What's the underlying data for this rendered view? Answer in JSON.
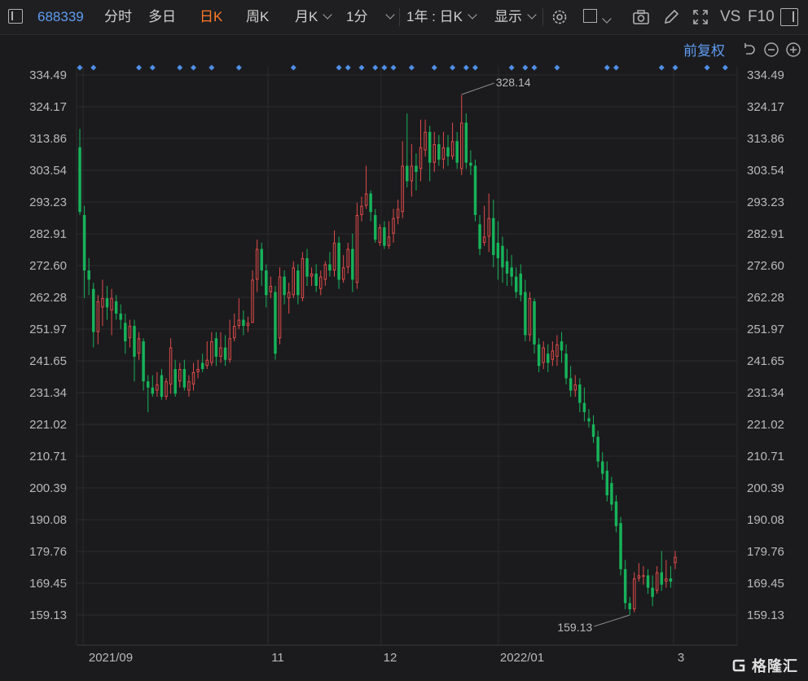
{
  "toolbar": {
    "stock_code": "688339",
    "tabs": [
      "分时",
      "多日",
      "日K",
      "周K",
      "月K",
      "1分"
    ],
    "active_tab": "日K",
    "period_select": "1年 : 日K",
    "display_label": "显示",
    "vs_label": "VS",
    "f10_label": "F10"
  },
  "adjust_label": "前复权",
  "colors": {
    "up": "#e14b4b",
    "down": "#17b35a",
    "marker": "#4f8fe8",
    "grid": "#2b2b2d",
    "annotation": "#8a8a8a"
  },
  "chart_data": {
    "type": "candlestick",
    "y_ticks": [
      "334.49",
      "324.17",
      "313.86",
      "303.54",
      "293.23",
      "282.91",
      "272.60",
      "262.28",
      "251.97",
      "241.65",
      "231.34",
      "221.02",
      "210.71",
      "200.39",
      "190.08",
      "179.76",
      "169.45",
      "159.13"
    ],
    "ylim": [
      159.13,
      334.49
    ],
    "x_labels": [
      "2021/09",
      "11",
      "12",
      "2022/01",
      "3"
    ],
    "annotations": [
      {
        "text": "328.14",
        "value": 328.14,
        "type": "high"
      },
      {
        "text": "159.13",
        "value": 159.13,
        "type": "low"
      }
    ],
    "series": [
      {
        "o": 311,
        "c": 290,
        "h": 317,
        "l": 289
      },
      {
        "o": 289,
        "c": 271,
        "h": 292,
        "l": 262
      },
      {
        "o": 271,
        "c": 268,
        "h": 275,
        "l": 263
      },
      {
        "o": 265,
        "c": 251,
        "h": 267,
        "l": 246
      },
      {
        "o": 251,
        "c": 261,
        "h": 263,
        "l": 247
      },
      {
        "o": 259,
        "c": 262,
        "h": 268,
        "l": 253
      },
      {
        "o": 262,
        "c": 259,
        "h": 266,
        "l": 255
      },
      {
        "o": 258,
        "c": 262,
        "h": 265,
        "l": 250
      },
      {
        "o": 261,
        "c": 257,
        "h": 263,
        "l": 255
      },
      {
        "o": 257,
        "c": 255,
        "h": 260,
        "l": 252
      },
      {
        "o": 254,
        "c": 248,
        "h": 257,
        "l": 244
      },
      {
        "o": 249,
        "c": 253,
        "h": 255,
        "l": 246
      },
      {
        "o": 253,
        "c": 243,
        "h": 255,
        "l": 235
      },
      {
        "o": 244,
        "c": 249,
        "h": 251,
        "l": 242
      },
      {
        "o": 248,
        "c": 235,
        "h": 249,
        "l": 232
      },
      {
        "o": 235,
        "c": 233,
        "h": 237,
        "l": 225
      },
      {
        "o": 233,
        "c": 231,
        "h": 237,
        "l": 230
      },
      {
        "o": 232,
        "c": 234,
        "h": 238,
        "l": 230
      },
      {
        "o": 237,
        "c": 230,
        "h": 239,
        "l": 229
      },
      {
        "o": 230,
        "c": 235,
        "h": 236,
        "l": 229
      },
      {
        "o": 234,
        "c": 246,
        "h": 249,
        "l": 231
      },
      {
        "o": 239,
        "c": 231,
        "h": 242,
        "l": 230
      },
      {
        "o": 235,
        "c": 239,
        "h": 241,
        "l": 233
      },
      {
        "o": 239,
        "c": 233,
        "h": 242,
        "l": 232
      },
      {
        "o": 232,
        "c": 235,
        "h": 237,
        "l": 230
      },
      {
        "o": 234,
        "c": 238,
        "h": 241,
        "l": 232
      },
      {
        "o": 238,
        "c": 239,
        "h": 242,
        "l": 236
      },
      {
        "o": 241,
        "c": 239,
        "h": 244,
        "l": 238
      },
      {
        "o": 240,
        "c": 242,
        "h": 248,
        "l": 239
      },
      {
        "o": 241,
        "c": 248,
        "h": 251,
        "l": 240
      },
      {
        "o": 249,
        "c": 243,
        "h": 251,
        "l": 240
      },
      {
        "o": 243,
        "c": 246,
        "h": 251,
        "l": 241
      },
      {
        "o": 246,
        "c": 242,
        "h": 250,
        "l": 240
      },
      {
        "o": 242,
        "c": 249,
        "h": 255,
        "l": 241
      },
      {
        "o": 249,
        "c": 253,
        "h": 257,
        "l": 248
      },
      {
        "o": 253,
        "c": 255,
        "h": 262,
        "l": 252
      },
      {
        "o": 255,
        "c": 253,
        "h": 258,
        "l": 250
      },
      {
        "o": 253,
        "c": 254,
        "h": 256,
        "l": 251
      },
      {
        "o": 254,
        "c": 268,
        "h": 271,
        "l": 254
      },
      {
        "o": 268,
        "c": 278,
        "h": 281,
        "l": 264
      },
      {
        "o": 278,
        "c": 271,
        "h": 280,
        "l": 266
      },
      {
        "o": 271,
        "c": 263,
        "h": 273,
        "l": 259
      },
      {
        "o": 264,
        "c": 266,
        "h": 269,
        "l": 262
      },
      {
        "o": 264,
        "c": 244,
        "h": 266,
        "l": 242
      },
      {
        "o": 249,
        "c": 269,
        "h": 272,
        "l": 247
      },
      {
        "o": 269,
        "c": 263,
        "h": 271,
        "l": 260
      },
      {
        "o": 262,
        "c": 264,
        "h": 267,
        "l": 257
      },
      {
        "o": 263,
        "c": 272,
        "h": 274,
        "l": 262
      },
      {
        "o": 271,
        "c": 263,
        "h": 273,
        "l": 260
      },
      {
        "o": 262,
        "c": 275,
        "h": 277,
        "l": 261
      },
      {
        "o": 275,
        "c": 269,
        "h": 278,
        "l": 266
      },
      {
        "o": 269,
        "c": 270,
        "h": 272,
        "l": 266
      },
      {
        "o": 270,
        "c": 266,
        "h": 273,
        "l": 264
      },
      {
        "o": 265,
        "c": 269,
        "h": 271,
        "l": 263
      },
      {
        "o": 268,
        "c": 273,
        "h": 274,
        "l": 266
      },
      {
        "o": 273,
        "c": 271,
        "h": 277,
        "l": 269
      },
      {
        "o": 271,
        "c": 280,
        "h": 284,
        "l": 269
      },
      {
        "o": 280,
        "c": 268,
        "h": 282,
        "l": 265
      },
      {
        "o": 268,
        "c": 272,
        "h": 276,
        "l": 267
      },
      {
        "o": 272,
        "c": 278,
        "h": 280,
        "l": 270
      },
      {
        "o": 278,
        "c": 268,
        "h": 283,
        "l": 264
      },
      {
        "o": 267,
        "c": 289,
        "h": 293,
        "l": 265
      },
      {
        "o": 289,
        "c": 292,
        "h": 295,
        "l": 287
      },
      {
        "o": 292,
        "c": 296,
        "h": 305,
        "l": 291
      },
      {
        "o": 296,
        "c": 290,
        "h": 297,
        "l": 287
      },
      {
        "o": 289,
        "c": 281,
        "h": 291,
        "l": 280
      },
      {
        "o": 280,
        "c": 285,
        "h": 286,
        "l": 279
      },
      {
        "o": 285,
        "c": 279,
        "h": 287,
        "l": 278
      },
      {
        "o": 279,
        "c": 282,
        "h": 287,
        "l": 278
      },
      {
        "o": 283,
        "c": 288,
        "h": 291,
        "l": 280
      },
      {
        "o": 288,
        "c": 291,
        "h": 294,
        "l": 286
      },
      {
        "o": 290,
        "c": 305,
        "h": 313,
        "l": 288
      },
      {
        "o": 305,
        "c": 300,
        "h": 322,
        "l": 298
      },
      {
        "o": 300,
        "c": 305,
        "h": 312,
        "l": 295
      },
      {
        "o": 305,
        "c": 303,
        "h": 309,
        "l": 297
      },
      {
        "o": 304,
        "c": 311,
        "h": 320,
        "l": 300
      },
      {
        "o": 310,
        "c": 316,
        "h": 320,
        "l": 308
      },
      {
        "o": 316,
        "c": 306,
        "h": 318,
        "l": 300
      },
      {
        "o": 306,
        "c": 312,
        "h": 316,
        "l": 303
      },
      {
        "o": 312,
        "c": 307,
        "h": 315,
        "l": 305
      },
      {
        "o": 307,
        "c": 311,
        "h": 316,
        "l": 304
      },
      {
        "o": 311,
        "c": 308,
        "h": 315,
        "l": 305
      },
      {
        "o": 308,
        "c": 313,
        "h": 319,
        "l": 307
      },
      {
        "o": 313,
        "c": 306,
        "h": 316,
        "l": 304
      },
      {
        "o": 304,
        "c": 319,
        "h": 328,
        "l": 302
      },
      {
        "o": 319,
        "c": 306,
        "h": 322,
        "l": 304
      },
      {
        "o": 306,
        "c": 305,
        "h": 310,
        "l": 302
      },
      {
        "o": 305,
        "c": 289,
        "h": 307,
        "l": 287
      },
      {
        "o": 286,
        "c": 278,
        "h": 289,
        "l": 276
      },
      {
        "o": 280,
        "c": 282,
        "h": 292,
        "l": 279
      },
      {
        "o": 282,
        "c": 288,
        "h": 296,
        "l": 277
      },
      {
        "o": 288,
        "c": 276,
        "h": 294,
        "l": 272
      },
      {
        "o": 280,
        "c": 275,
        "h": 287,
        "l": 268
      },
      {
        "o": 279,
        "c": 272,
        "h": 282,
        "l": 267
      },
      {
        "o": 274,
        "c": 270,
        "h": 278,
        "l": 266
      },
      {
        "o": 272,
        "c": 269,
        "h": 276,
        "l": 266
      },
      {
        "o": 269,
        "c": 264,
        "h": 272,
        "l": 262
      },
      {
        "o": 270,
        "c": 263,
        "h": 273,
        "l": 261
      },
      {
        "o": 264,
        "c": 250,
        "h": 268,
        "l": 248
      },
      {
        "o": 250,
        "c": 262,
        "h": 264,
        "l": 248
      },
      {
        "o": 261,
        "c": 247,
        "h": 262,
        "l": 244
      },
      {
        "o": 247,
        "c": 240,
        "h": 249,
        "l": 238
      },
      {
        "o": 241,
        "c": 246,
        "h": 248,
        "l": 239
      },
      {
        "o": 244,
        "c": 241,
        "h": 247,
        "l": 238
      },
      {
        "o": 242,
        "c": 245,
        "h": 248,
        "l": 240
      },
      {
        "o": 243,
        "c": 247,
        "h": 250,
        "l": 240
      },
      {
        "o": 248,
        "c": 245,
        "h": 251,
        "l": 241
      },
      {
        "o": 244,
        "c": 236,
        "h": 247,
        "l": 234
      },
      {
        "o": 236,
        "c": 232,
        "h": 240,
        "l": 230
      },
      {
        "o": 232,
        "c": 234,
        "h": 237,
        "l": 230
      },
      {
        "o": 234,
        "c": 228,
        "h": 236,
        "l": 225
      },
      {
        "o": 228,
        "c": 225,
        "h": 233,
        "l": 222
      },
      {
        "o": 223,
        "c": 222,
        "h": 226,
        "l": 220
      },
      {
        "o": 221,
        "c": 217,
        "h": 224,
        "l": 215
      },
      {
        "o": 217,
        "c": 209,
        "h": 219,
        "l": 207
      },
      {
        "o": 209,
        "c": 205,
        "h": 212,
        "l": 203
      },
      {
        "o": 206,
        "c": 198,
        "h": 209,
        "l": 196
      },
      {
        "o": 202,
        "c": 195,
        "h": 204,
        "l": 193
      },
      {
        "o": 196,
        "c": 188,
        "h": 198,
        "l": 186
      },
      {
        "o": 189,
        "c": 174,
        "h": 191,
        "l": 172
      },
      {
        "o": 174,
        "c": 163,
        "h": 177,
        "l": 161
      },
      {
        "o": 163,
        "c": 161,
        "h": 165,
        "l": 159.13
      },
      {
        "o": 161,
        "c": 171,
        "h": 173,
        "l": 160
      },
      {
        "o": 171,
        "c": 172,
        "h": 176,
        "l": 170
      },
      {
        "o": 172,
        "c": 172,
        "h": 175,
        "l": 169
      },
      {
        "o": 172,
        "c": 168,
        "h": 174,
        "l": 166
      },
      {
        "o": 168,
        "c": 165,
        "h": 172,
        "l": 162
      },
      {
        "o": 167,
        "c": 173,
        "h": 175,
        "l": 166
      },
      {
        "o": 173,
        "c": 169,
        "h": 180,
        "l": 167
      },
      {
        "o": 170,
        "c": 171,
        "h": 177,
        "l": 168
      },
      {
        "o": 171,
        "c": 170,
        "h": 175,
        "l": 168
      },
      {
        "o": 176,
        "c": 178,
        "h": 180,
        "l": 174
      }
    ],
    "marker_positions": [
      0,
      3,
      13,
      16,
      22,
      25,
      29,
      35,
      47,
      57,
      59,
      62,
      65,
      67,
      69,
      73,
      78,
      82,
      85,
      87,
      95,
      98,
      100,
      105,
      116,
      118,
      128,
      131,
      138,
      142
    ]
  }
}
